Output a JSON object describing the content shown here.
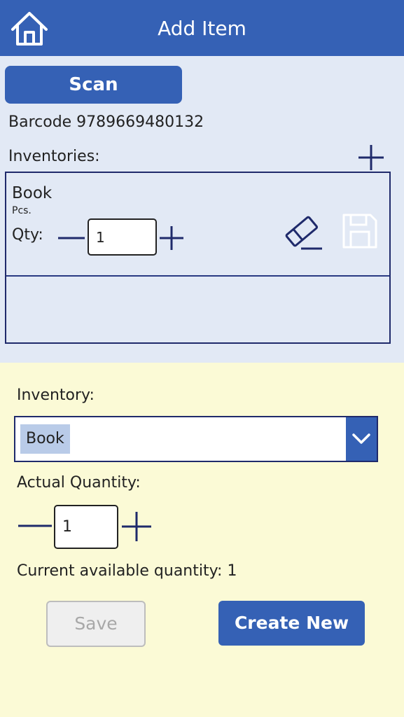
{
  "header": {
    "title": "Add Item",
    "home_icon": "home-icon",
    "color": "#3561b5"
  },
  "scan": {
    "label": "Scan"
  },
  "barcode": {
    "text": "Barcode 9789669480132"
  },
  "inventories": {
    "label": "Inventories:",
    "add_icon": "plus-icon",
    "items": [
      {
        "name": "Book",
        "unit": "Pcs.",
        "qty_label": "Qty:",
        "qty": "1",
        "erase_icon": "eraser-icon",
        "save_icon": "save-icon"
      }
    ]
  },
  "form": {
    "inventory_label": "Inventory:",
    "inventory_selected": "Book",
    "actual_quantity_label": "Actual Quantity:",
    "actual_quantity": "1",
    "current_available_text": "Current available quantity: 1",
    "save_label": "Save",
    "create_new_label": "Create New"
  },
  "colors": {
    "accent": "#3561b5",
    "top_bg": "#e2e9f5",
    "bottom_bg": "#fbfad6",
    "border": "#1f2a6b"
  }
}
